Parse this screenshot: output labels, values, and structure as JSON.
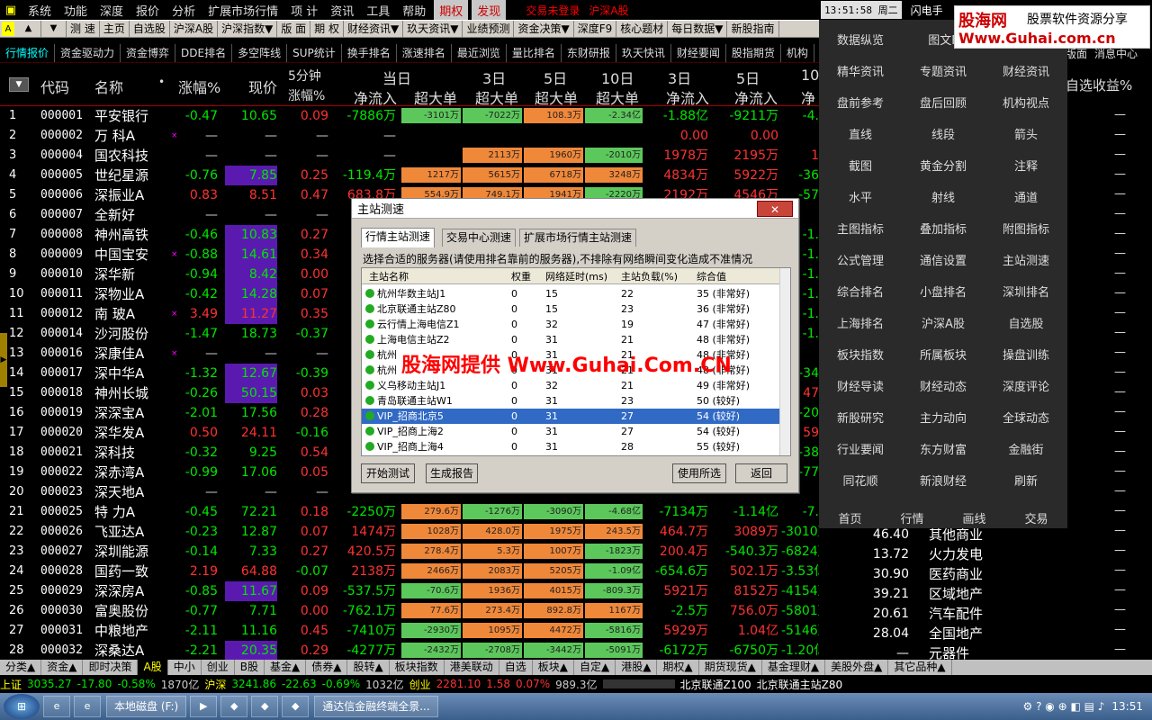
{
  "menu": {
    "items": [
      "系统",
      "功能",
      "深度",
      "报价",
      "分析",
      "扩展市场行情",
      "资讯",
      "工具",
      "帮助"
    ],
    "extra": "项 计",
    "highlight": [
      "期权",
      "发现"
    ],
    "status_login": "交易未登录",
    "status_market": "沪深A股"
  },
  "toolbar": {
    "items": [
      "测 速",
      "主页",
      "自选股",
      "沪深A股",
      "沪深指数▼",
      "版 面",
      "期 权",
      "财经资讯▼",
      "玖天资讯▼",
      "业绩预测",
      "资金决策▼",
      "深度F9",
      "核心题材",
      "每日数据▼",
      "新股指南"
    ]
  },
  "tabs": {
    "items": [
      "行情报价",
      "资金驱动力",
      "资金博弈",
      "DDE排名",
      "多空阵线",
      "SUP统计",
      "换手排名",
      "涨速排名",
      "最近浏览",
      "量比排名",
      "东财研报",
      "玖天快讯",
      "财经要闻",
      "股指期货",
      "机构"
    ],
    "right_items": [
      "版面",
      "消息中心"
    ]
  },
  "clock": "13:51:58 周二",
  "flash": "闪电手",
  "watermark": {
    "brand": "股海网",
    "tagline": "股票软件资源分享",
    "url": "Www.Guhai.com.cn",
    "center": "股海网提供 Www.Guhai.Com.CN"
  },
  "header": {
    "code": "代码",
    "name": "名称",
    "dot": "•",
    "pct": "涨幅%",
    "price": "现价",
    "five_min_top": "5分钟",
    "five_min_bot": "涨幅%",
    "today": "当日",
    "netflow": "净流入",
    "super": "超大单",
    "day3": "3日",
    "day5": "5日",
    "day10": "10日",
    "day3b": "3日",
    "day5b": "5日",
    "day10b": "10",
    "net3": "净流入",
    "net5": "净流入",
    "net10": "净",
    "right_sel": "自选收益%"
  },
  "rows": [
    {
      "no": "1",
      "code": "000001",
      "name": "平安银行",
      "mark": "",
      "pct": "-0.47",
      "price": "10.65",
      "m5": "0.09",
      "net": "-7886万",
      "b1": "-3101万",
      "b3": "-7022万",
      "b5": "108.3万",
      "b10": "-2.34亿",
      "n3": "-1.88亿",
      "n5": "-9211万",
      "n10": "-4."
    },
    {
      "no": "2",
      "code": "000002",
      "name": "万 科A",
      "mark": "×",
      "pct": "—",
      "price": "—",
      "m5": "—",
      "net": "—",
      "b1": "",
      "b3": "",
      "b5": "",
      "b10": "",
      "n3": "0.00",
      "n5": "0.00",
      "n10": ""
    },
    {
      "no": "3",
      "code": "000004",
      "name": "国农科技",
      "mark": "",
      "pct": "—",
      "price": "—",
      "m5": "—",
      "net": "—",
      "b1": "",
      "b3": "2113万",
      "b5": "1960万",
      "b10": "-2010万",
      "n3": "1978万",
      "n5": "2195万",
      "n10": "1"
    },
    {
      "no": "4",
      "code": "000005",
      "name": "世纪星源",
      "mark": "",
      "pct": "-0.76",
      "price": "7.85",
      "m5": "0.25",
      "net": "-119.4万",
      "b1": "1217万",
      "b3": "5615万",
      "b5": "6718万",
      "b10": "3248万",
      "n3": "4834万",
      "n5": "5922万",
      "n10": "-36"
    },
    {
      "no": "5",
      "code": "000006",
      "name": "深振业A",
      "mark": "",
      "pct": "0.83",
      "price": "8.51",
      "m5": "0.47",
      "net": "683.8万",
      "b1": "554.9万",
      "b3": "749.1万",
      "b5": "1941万",
      "b10": "-2220万",
      "n3": "2192万",
      "n5": "4546万",
      "n10": "-57"
    },
    {
      "no": "6",
      "code": "000007",
      "name": "全新好",
      "mark": "",
      "pct": "—",
      "price": "—",
      "m5": "—",
      "net": "—",
      "b1": "",
      "b3": "",
      "b5": "",
      "b10": "",
      "n3": "",
      "n5": "",
      "n10": ""
    },
    {
      "no": "7",
      "code": "000008",
      "name": "神州高铁",
      "mark": "",
      "pct": "-0.46",
      "price": "10.83",
      "m5": "0.27",
      "net": "",
      "b1": "",
      "b3": "",
      "b5": "",
      "b10": "",
      "n3": "",
      "n5": "",
      "n10": "-1."
    },
    {
      "no": "8",
      "code": "000009",
      "name": "中国宝安",
      "mark": "×",
      "pct": "-0.88",
      "price": "14.61",
      "m5": "0.34",
      "net": "",
      "b1": "",
      "b3": "",
      "b5": "",
      "b10": "",
      "n3": "",
      "n5": "",
      "n10": "-1."
    },
    {
      "no": "9",
      "code": "000010",
      "name": "深华新",
      "mark": "",
      "pct": "-0.94",
      "price": "8.42",
      "m5": "0.00",
      "net": "",
      "b1": "",
      "b3": "",
      "b5": "",
      "b10": "",
      "n3": "",
      "n5": "",
      "n10": "-1."
    },
    {
      "no": "10",
      "code": "000011",
      "name": "深物业A",
      "mark": "",
      "pct": "-0.42",
      "price": "14.28",
      "m5": "0.07",
      "net": "",
      "b1": "",
      "b3": "",
      "b5": "",
      "b10": "",
      "n3": "",
      "n5": "",
      "n10": "-1."
    },
    {
      "no": "11",
      "code": "000012",
      "name": "南 玻A",
      "mark": "×",
      "pct": "3.49",
      "price": "11.27",
      "m5": "0.35",
      "net": "",
      "b1": "",
      "b3": "",
      "b5": "",
      "b10": "",
      "n3": "",
      "n5": "",
      "n10": "-1."
    },
    {
      "no": "12",
      "code": "000014",
      "name": "沙河股份",
      "mark": "",
      "pct": "-1.47",
      "price": "18.73",
      "m5": "-0.37",
      "net": "",
      "b1": "",
      "b3": "",
      "b5": "",
      "b10": "",
      "n3": "",
      "n5": "",
      "n10": "-1."
    },
    {
      "no": "13",
      "code": "000016",
      "name": "深康佳A",
      "mark": "×",
      "pct": "—",
      "price": "—",
      "m5": "—",
      "net": "",
      "b1": "",
      "b3": "",
      "b5": "",
      "b10": "",
      "n3": "",
      "n5": "",
      "n10": ""
    },
    {
      "no": "14",
      "code": "000017",
      "name": "深中华A",
      "mark": "",
      "pct": "-1.32",
      "price": "12.67",
      "m5": "-0.39",
      "net": "",
      "b1": "",
      "b3": "",
      "b5": "",
      "b10": "",
      "n3": "",
      "n5": "",
      "n10": "-34"
    },
    {
      "no": "15",
      "code": "000018",
      "name": "神州长城",
      "mark": "",
      "pct": "-0.26",
      "price": "50.15",
      "m5": "0.03",
      "net": "",
      "b1": "",
      "b3": "",
      "b5": "",
      "b10": "",
      "n3": "",
      "n5": "",
      "n10": "47"
    },
    {
      "no": "16",
      "code": "000019",
      "name": "深深宝A",
      "mark": "",
      "pct": "-2.01",
      "price": "17.56",
      "m5": "0.28",
      "net": "",
      "b1": "",
      "b3": "",
      "b5": "",
      "b10": "",
      "n3": "",
      "n5": "",
      "n10": "-20"
    },
    {
      "no": "17",
      "code": "000020",
      "name": "深华发A",
      "mark": "",
      "pct": "0.50",
      "price": "24.11",
      "m5": "-0.16",
      "net": "",
      "b1": "",
      "b3": "",
      "b5": "",
      "b10": "",
      "n3": "",
      "n5": "",
      "n10": "59"
    },
    {
      "no": "18",
      "code": "000021",
      "name": "深科技",
      "mark": "",
      "pct": "-0.32",
      "price": "9.25",
      "m5": "0.54",
      "net": "",
      "b1": "",
      "b3": "",
      "b5": "",
      "b10": "",
      "n3": "",
      "n5": "",
      "n10": "-38"
    },
    {
      "no": "19",
      "code": "000022",
      "name": "深赤湾A",
      "mark": "",
      "pct": "-0.99",
      "price": "17.06",
      "m5": "0.05",
      "net": "",
      "b1": "",
      "b3": "",
      "b5": "",
      "b10": "",
      "n3": "",
      "n5": "",
      "n10": "-77"
    },
    {
      "no": "20",
      "code": "000023",
      "name": "深天地A",
      "mark": "",
      "pct": "—",
      "price": "—",
      "m5": "—",
      "net": "",
      "b1": "",
      "b3": "",
      "b5": "",
      "b10": "",
      "n3": "",
      "n5": "",
      "n10": ""
    },
    {
      "no": "21",
      "code": "000025",
      "name": "特 力A",
      "mark": "",
      "pct": "-0.45",
      "price": "72.21",
      "m5": "0.18",
      "net": "-2250万",
      "b1": "279.6万",
      "b3": "-1276万",
      "b5": "-3090万",
      "b10": "-4.68亿",
      "n3": "-7134万",
      "n5": "-1.14亿",
      "n10": "-7."
    },
    {
      "no": "22",
      "code": "000026",
      "name": "飞亚达A",
      "mark": "",
      "pct": "-0.23",
      "price": "12.87",
      "m5": "0.07",
      "net": "1474万",
      "b1": "1028万",
      "b3": "428.0万",
      "b5": "1975万",
      "b10": "243.5万",
      "n3": "464.7万",
      "n5": "3089万",
      "n10": "-3010万"
    },
    {
      "no": "23",
      "code": "000027",
      "name": "深圳能源",
      "mark": "",
      "pct": "-0.14",
      "price": "7.33",
      "m5": "0.27",
      "net": "420.5万",
      "b1": "278.4万",
      "b3": "5.3万",
      "b5": "1007万",
      "b10": "-1823万",
      "n3": "200.4万",
      "n5": "-540.3万",
      "n10": "-6824万"
    },
    {
      "no": "24",
      "code": "000028",
      "name": "国药一致",
      "mark": "",
      "pct": "2.19",
      "price": "64.88",
      "m5": "-0.07",
      "net": "2138万",
      "b1": "2466万",
      "b3": "2083万",
      "b5": "5205万",
      "b10": "-1.09亿",
      "n3": "-654.6万",
      "n5": "502.1万",
      "n10": "-3.53亿"
    },
    {
      "no": "25",
      "code": "000029",
      "name": "深深房A",
      "mark": "",
      "pct": "-0.85",
      "price": "11.67",
      "m5": "0.09",
      "net": "-537.5万",
      "b1": "-70.6万",
      "b3": "1936万",
      "b5": "4015万",
      "b10": "-809.3万",
      "n3": "5921万",
      "n5": "8152万",
      "n10": "-4154万"
    },
    {
      "no": "26",
      "code": "000030",
      "name": "富奥股份",
      "mark": "",
      "pct": "-0.77",
      "price": "7.71",
      "m5": "0.00",
      "net": "-762.1万",
      "b1": "77.6万",
      "b3": "273.4万",
      "b5": "892.8万",
      "b10": "1167万",
      "n3": "-2.5万",
      "n5": "756.0万",
      "n10": "-5801万"
    },
    {
      "no": "27",
      "code": "000031",
      "name": "中粮地产",
      "mark": "",
      "pct": "-2.11",
      "price": "11.16",
      "m5": "0.45",
      "net": "-7410万",
      "b1": "-2930万",
      "b3": "1095万",
      "b5": "4472万",
      "b10": "-5816万",
      "n3": "5929万",
      "n5": "1.04亿",
      "n10": "-5146万"
    },
    {
      "no": "28",
      "code": "000032",
      "name": "深桑达A",
      "mark": "",
      "pct": "-2.21",
      "price": "20.35",
      "m5": "0.29",
      "net": "-4277万",
      "b1": "-2432万",
      "b3": "-2708万",
      "b5": "-3442万",
      "b10": "-5091万",
      "n3": "-6172万",
      "n5": "-6750万",
      "n10": "-1.20亿"
    }
  ],
  "right_rows": [
    {
      "pe": "46.40",
      "ind": "其他商业",
      "dash": "—"
    },
    {
      "pe": "13.72",
      "ind": "火力发电",
      "dash": "—"
    },
    {
      "pe": "30.90",
      "ind": "医药商业",
      "dash": "—"
    },
    {
      "pe": "39.21",
      "ind": "区域地产",
      "dash": "—"
    },
    {
      "pe": "20.61",
      "ind": "汽车配件",
      "dash": "—"
    },
    {
      "pe": "28.04",
      "ind": "全国地产",
      "dash": "—"
    },
    {
      "pe": "—",
      "ind": "元器件",
      "dash": "—"
    }
  ],
  "overlay": {
    "items": [
      "数据纵览",
      "图文F",
      "",
      "精华资讯",
      "专题资讯",
      "财经资讯",
      "盘前参考",
      "盘后回顾",
      "机构视点",
      "直线",
      "线段",
      "箭头",
      "截图",
      "黄金分割",
      "注释",
      "水平",
      "射线",
      "通道",
      "主图指标",
      "叠加指标",
      "附图指标",
      "公式管理",
      "通信设置",
      "主站测速",
      "综合排名",
      "小盘排名",
      "深圳排名",
      "上海排名",
      "沪深A股",
      "自选股",
      "板块指数",
      "所属板块",
      "操盘训练",
      "财经导读",
      "财经动态",
      "深度评论",
      "新股研究",
      "主力动向",
      "全球动态",
      "行业要闻",
      "东方财富",
      "金融街",
      "同花顺",
      "新浪财经",
      "刷新"
    ],
    "bottom": [
      "首页",
      "行情",
      "画线",
      "交易"
    ]
  },
  "dialog": {
    "title": "主站测速",
    "tabs": [
      "行情主站测速",
      "交易中心测速",
      "扩展市场行情主站测速"
    ],
    "note": "选择合适的服务器(请使用排名靠前的服务器),不排除有网络瞬间变化造成不准情况",
    "columns": [
      "主站名称",
      "权重",
      "网络延时(ms)",
      "主站负载(%)",
      "综合值"
    ],
    "servers": [
      {
        "name": "杭州华数主站J1",
        "w": "0",
        "lat": "15",
        "load": "22",
        "score": "35 (非常好)"
      },
      {
        "name": "北京联通主站Z80",
        "w": "0",
        "lat": "15",
        "load": "23",
        "score": "36 (非常好)"
      },
      {
        "name": "云行情上海电信Z1",
        "w": "0",
        "lat": "32",
        "load": "19",
        "score": "47 (非常好)"
      },
      {
        "name": "上海电信主站Z2",
        "w": "0",
        "lat": "31",
        "load": "21",
        "score": "48 (非常好)"
      },
      {
        "name": "杭州",
        "w": "0",
        "lat": "31",
        "load": "21",
        "score": "48 (非常好)"
      },
      {
        "name": "杭州",
        "w": "0",
        "lat": "31",
        "load": "21",
        "score": "48 (非常好)"
      },
      {
        "name": "义乌移动主站J1",
        "w": "0",
        "lat": "32",
        "load": "21",
        "score": "49 (非常好)"
      },
      {
        "name": "青岛联通主站W1",
        "w": "0",
        "lat": "31",
        "load": "23",
        "score": "50 (较好)"
      },
      {
        "name": "VIP_招商北京5",
        "w": "0",
        "lat": "31",
        "load": "27",
        "score": "54 (较好)"
      },
      {
        "name": "VIP_招商上海2",
        "w": "0",
        "lat": "31",
        "load": "27",
        "score": "54 (较好)"
      },
      {
        "name": "VIP_招商上海4",
        "w": "0",
        "lat": "31",
        "load": "28",
        "score": "55 (较好)"
      }
    ],
    "btn_start": "开始测试",
    "btn_report": "生成报告",
    "btn_use": "使用所选",
    "btn_back": "返回",
    "close": "✕"
  },
  "bottom_tabs": [
    "分类▲",
    "资金▲",
    "即时决策",
    "A股",
    "中小",
    "创业",
    "B股",
    "基金▲",
    "债券▲",
    "股转▲",
    "板块指数",
    "港美联动",
    "自选",
    "板块▲",
    "自定▲",
    "港股▲",
    "期权▲",
    "期货现货▲",
    "基金理财▲",
    "美股外盘▲",
    "其它品种▲"
  ],
  "statusbar": {
    "sh_label": "上证",
    "sh_val": "3035.27",
    "sh_chg": "-17.80",
    "sh_pct": "-0.58%",
    "sh_amt": "1870亿",
    "hs_label": "沪深",
    "hs_val": "3241.86",
    "hs_chg": "-22.63",
    "hs_pct": "-0.69%",
    "hs_amt": "1032亿",
    "cy_label": "创业",
    "cy_val": "2281.10",
    "cy_chg": "1.58",
    "cy_pct": "0.07%",
    "cy_amt": "989.3亿",
    "server1": "北京联通Z100",
    "server2": "北京联通主站Z80"
  },
  "taskbar": {
    "start": "⊞",
    "disk": "本地磁盘 (F:)",
    "app": "通达信金融终端全景...",
    "time": "13:51"
  }
}
